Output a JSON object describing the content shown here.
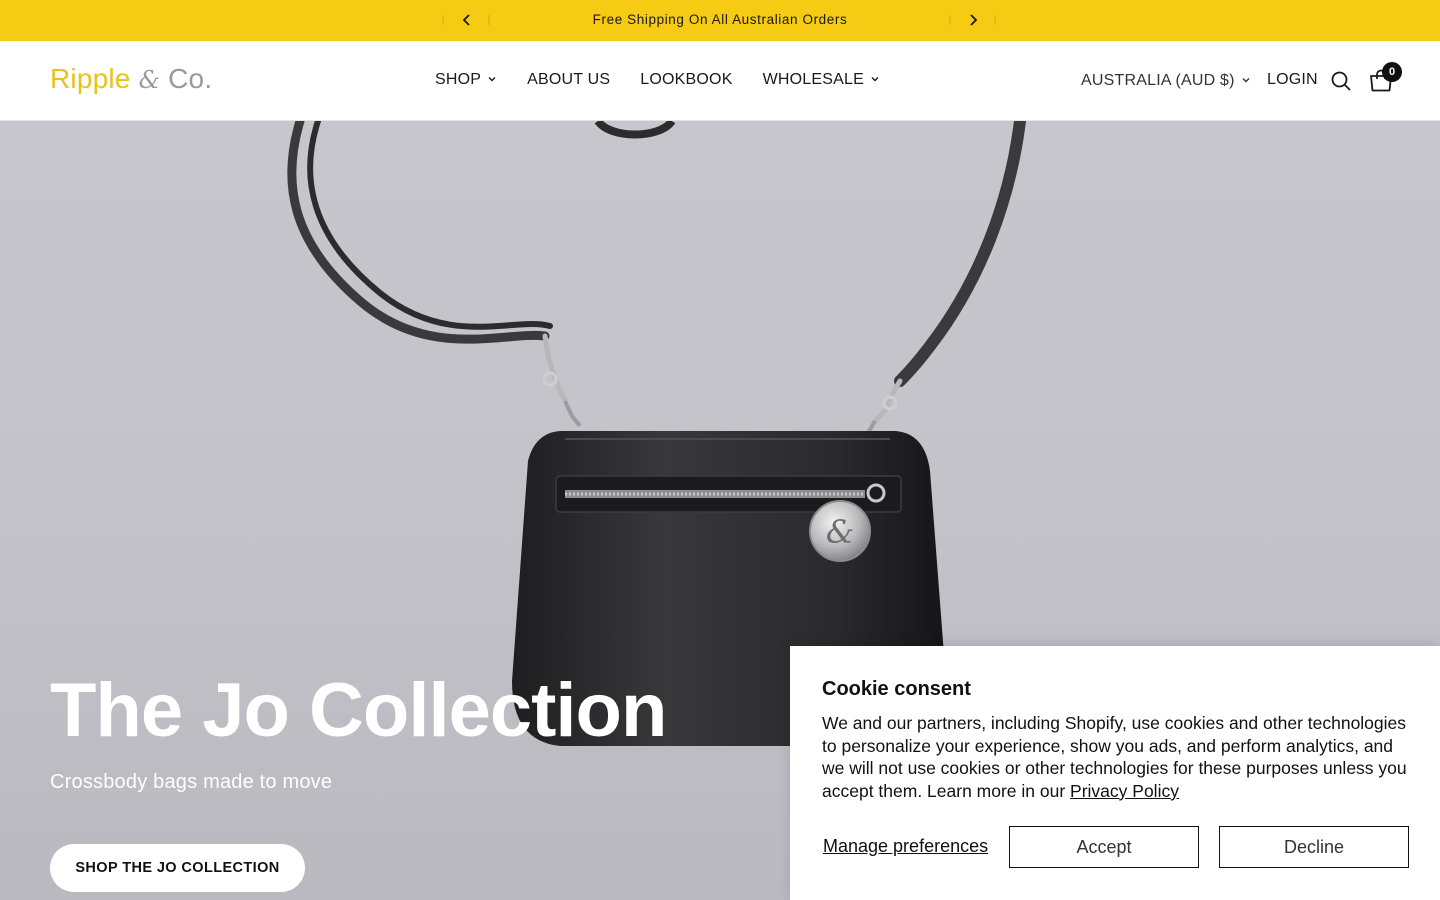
{
  "announcement": {
    "message": "Free Shipping On All Australian Orders",
    "prev_icon": "chevron-left-icon",
    "next_icon": "chevron-right-icon"
  },
  "header": {
    "logo": {
      "main": "Ripple",
      "amp": "&",
      "suffix": "Co."
    },
    "nav": [
      {
        "label": "SHOP",
        "has_dropdown": true
      },
      {
        "label": "ABOUT US",
        "has_dropdown": false
      },
      {
        "label": "LOOKBOOK",
        "has_dropdown": false
      },
      {
        "label": "WHOLESALE",
        "has_dropdown": true
      }
    ],
    "currency": "AUSTRALIA (AUD $)",
    "login": "LOGIN",
    "cart_count": "0"
  },
  "hero": {
    "title": "The Jo Collection",
    "subtitle": "Crossbody bags made to move",
    "cta": "SHOP THE JO COLLECTION"
  },
  "cookie": {
    "title": "Cookie consent",
    "body": "We and our partners, including Shopify, use cookies and other technologies to personalize your experience, show you ads, and perform analytics, and we will not use cookies or other technologies for these purposes unless you accept them. Learn more in our ",
    "link": "Privacy Policy",
    "manage": "Manage preferences",
    "accept": "Accept",
    "decline": "Decline"
  },
  "colors": {
    "announcement_bg": "#f6cb13",
    "logo_yellow": "#e8c21e",
    "hero_bg": "#c4c4ca"
  }
}
